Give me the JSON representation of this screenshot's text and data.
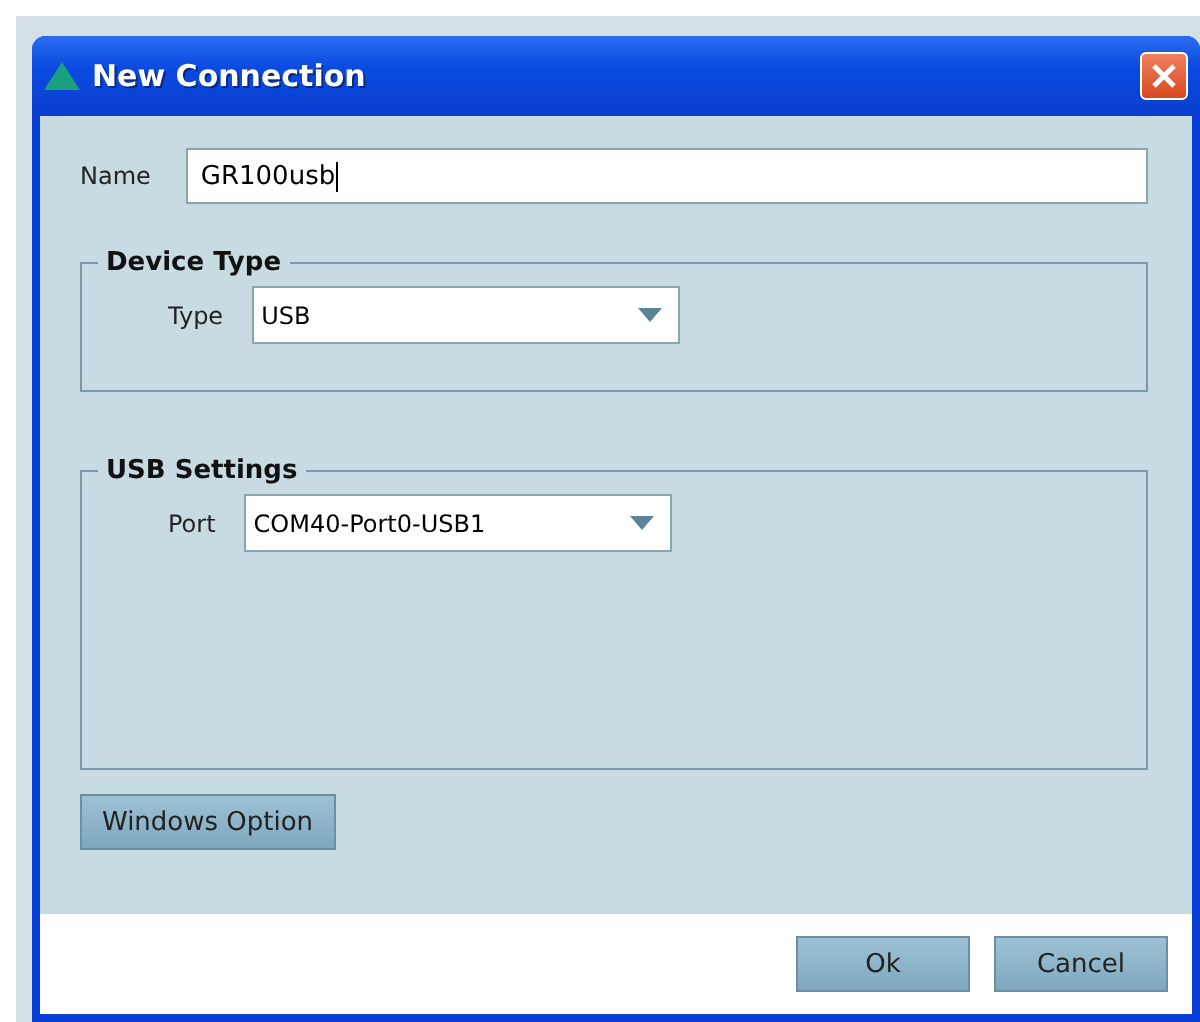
{
  "window": {
    "title": "New Connection"
  },
  "name_field": {
    "label": "Name",
    "value": "GR100usb"
  },
  "device_type": {
    "title": "Device Type",
    "label": "Type",
    "value": "USB"
  },
  "usb_settings": {
    "title": "USB Settings",
    "label": "Port",
    "value": "COM40-Port0-USB1"
  },
  "option_button": "Windows Option",
  "buttons": [
    "Ok",
    "Cancel"
  ]
}
